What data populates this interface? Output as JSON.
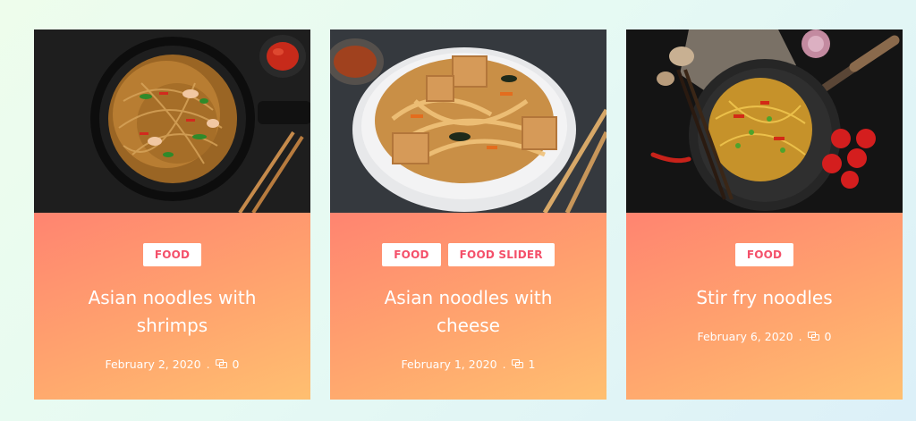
{
  "cards": [
    {
      "tags": [
        "FOOD"
      ],
      "title": "Asian noodles with shrimps",
      "date": "February 2, 2020",
      "separator": ".",
      "comments": "0",
      "comment_icon": "comment-icon"
    },
    {
      "tags": [
        "FOOD",
        "FOOD SLIDER"
      ],
      "title": "Asian noodles with cheese",
      "date": "February 1, 2020",
      "separator": ".",
      "comments": "1",
      "comment_icon": "comment-icon"
    },
    {
      "tags": [
        "FOOD"
      ],
      "title": "Stir fry noodles",
      "date": "February 6, 2020",
      "separator": ".",
      "comments": "0",
      "comment_icon": "comment-icon"
    }
  ],
  "colors": {
    "card_gradient_start": "#ff8470",
    "card_gradient_end": "#ffbf70",
    "tag_text": "#f4506a",
    "page_bg": "#e6faf3"
  }
}
